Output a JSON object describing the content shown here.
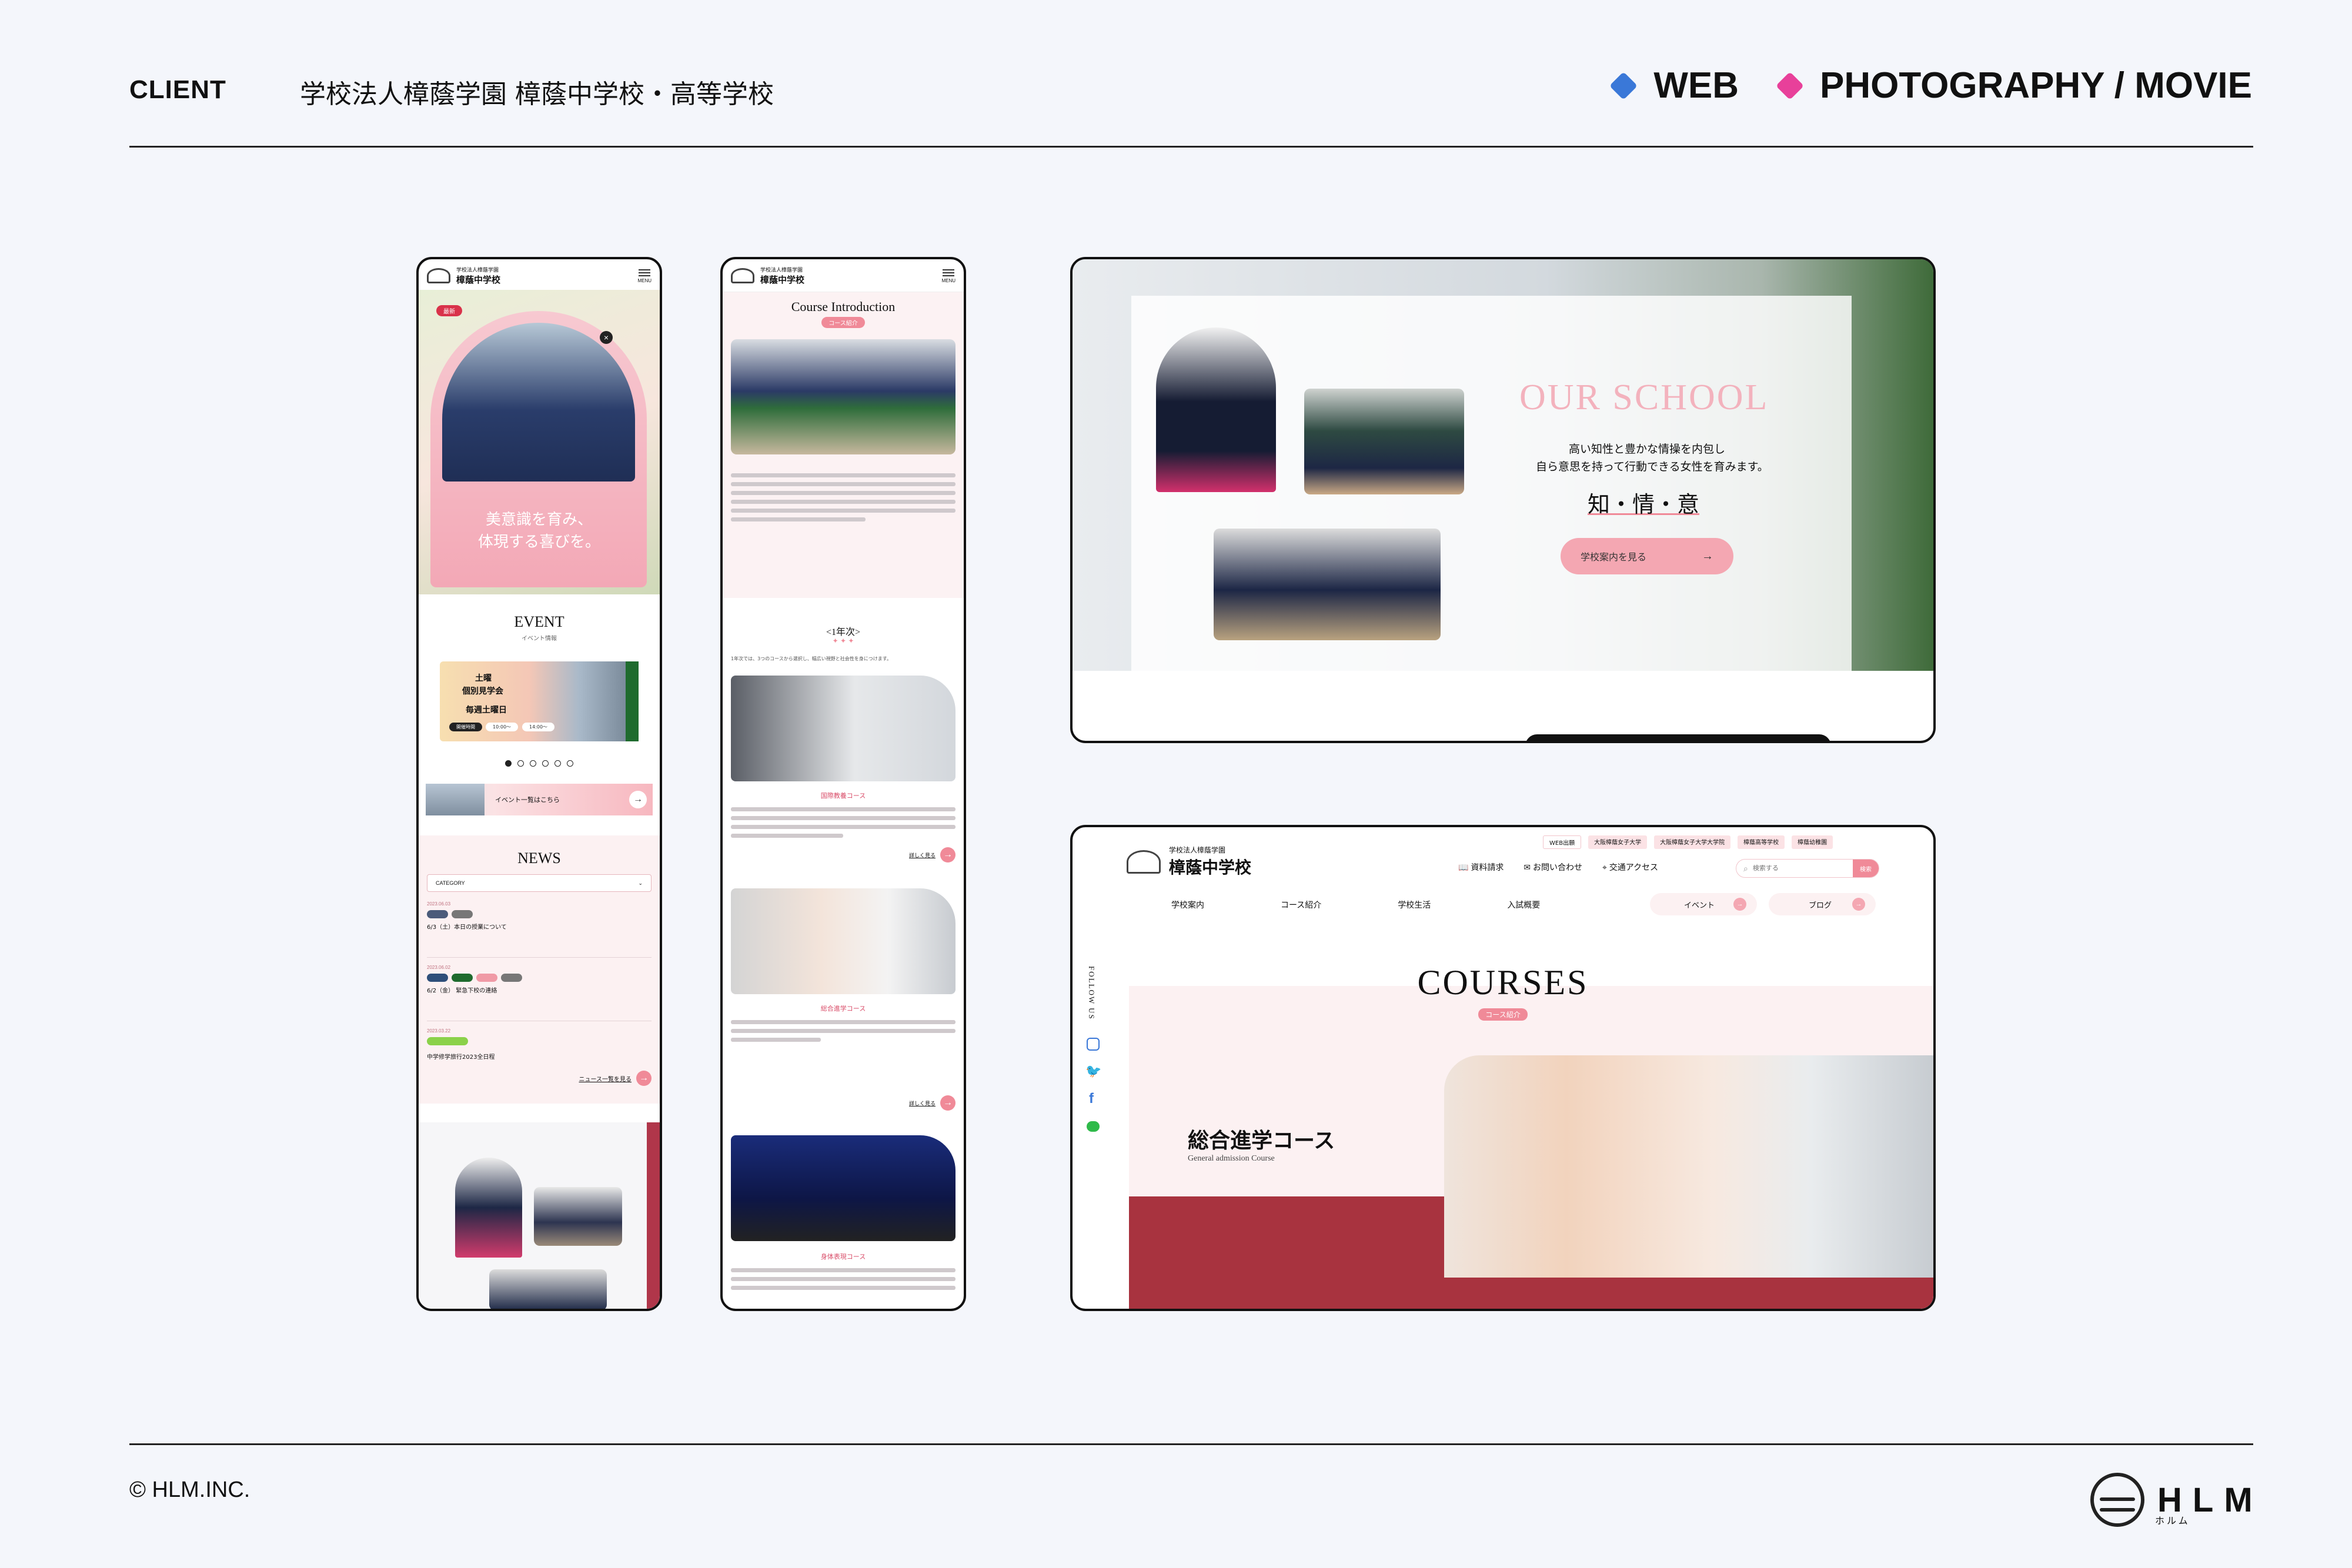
{
  "header": {
    "client_label": "CLIENT",
    "client_name": "学校法人樟蔭学園 樟蔭中学校・高等学校",
    "tags": [
      {
        "label": "WEB",
        "color": "#3a78d8"
      },
      {
        "label": "PHOTOGRAPHY / MOVIE",
        "color": "#e8409a"
      }
    ]
  },
  "footer": {
    "copyright": "© HLM.INC.",
    "logo_text": "HLM",
    "logo_sub": "ホルム"
  },
  "phone1": {
    "school_small": "学校法人樟蔭学園",
    "school": "樟蔭中学校",
    "menu": "MENU",
    "hero_tag": "最新",
    "hero_text_1": "美意識を育み、",
    "hero_text_2": "体現する喜びを。",
    "event_title": "EVENT",
    "event_sub": "イベント情報",
    "event_card_1": "土曜",
    "event_card_2": "個別見学会",
    "event_card_3": "毎週土曜日",
    "event_time_label": "開催時間",
    "event_time_1": "10:00〜",
    "event_time_2": "14:00〜",
    "event_link": "イベント一覧はこちら",
    "news_title": "NEWS",
    "category": "CATEGORY",
    "news": [
      {
        "date": "2023.06.03",
        "title": "6/3（土）本日の授業について"
      },
      {
        "date": "2023.06.02",
        "title": "6/2（金） 緊急下校の連絡"
      },
      {
        "date": "2023.03.22",
        "title": "中学修学旅行2023全日程"
      }
    ],
    "news_link": "ニュース一覧を見る"
  },
  "phone2": {
    "school_small": "学校法人樟蔭学園",
    "school": "樟蔭中学校",
    "menu": "MENU",
    "title": "Course Introduction",
    "badge": "コース紹介",
    "year_title": "<1年次>",
    "year_text": "1年次では、3つのコースから選択し、幅広い視野と社会性を身につけます。",
    "course_1": "国際教養コース",
    "course_2": "総合進学コース",
    "course_3": "身体表現コース",
    "more": "詳しく見る"
  },
  "desktop1": {
    "heading": "OUR SCHOOL",
    "line_1": "高い知性と豊かな情操を内包し",
    "line_2": "自ら意思を持って行動できる女性を育みます。",
    "motto": "知・情・意",
    "button": "学校案内を見る"
  },
  "desktop2": {
    "school_small": "学校法人樟蔭学園",
    "school": "樟蔭中学校",
    "top_links": [
      "WEB出願",
      "大阪樟蔭女子大学",
      "大阪樟蔭女子大学大学院",
      "樟蔭高等学校",
      "樟蔭幼稚園"
    ],
    "utility": [
      "資料請求",
      "お問い合わせ",
      "交通アクセス"
    ],
    "search_placeholder": "検索する",
    "search_button": "検索",
    "nav": [
      "学校案内",
      "コース紹介",
      "学校生活",
      "入試概要"
    ],
    "nav_right": [
      "イベント",
      "ブログ"
    ],
    "follow": "FOLLOW US",
    "courses": "COURSES",
    "courses_badge": "コース紹介",
    "course_title": "総合進学コース",
    "course_sub": "General admission Course"
  },
  "colors": {
    "pink": "#f08a98",
    "soft_pink": "#fbe9ec",
    "maroon": "#a8333f",
    "green": "#2f6d3b"
  }
}
